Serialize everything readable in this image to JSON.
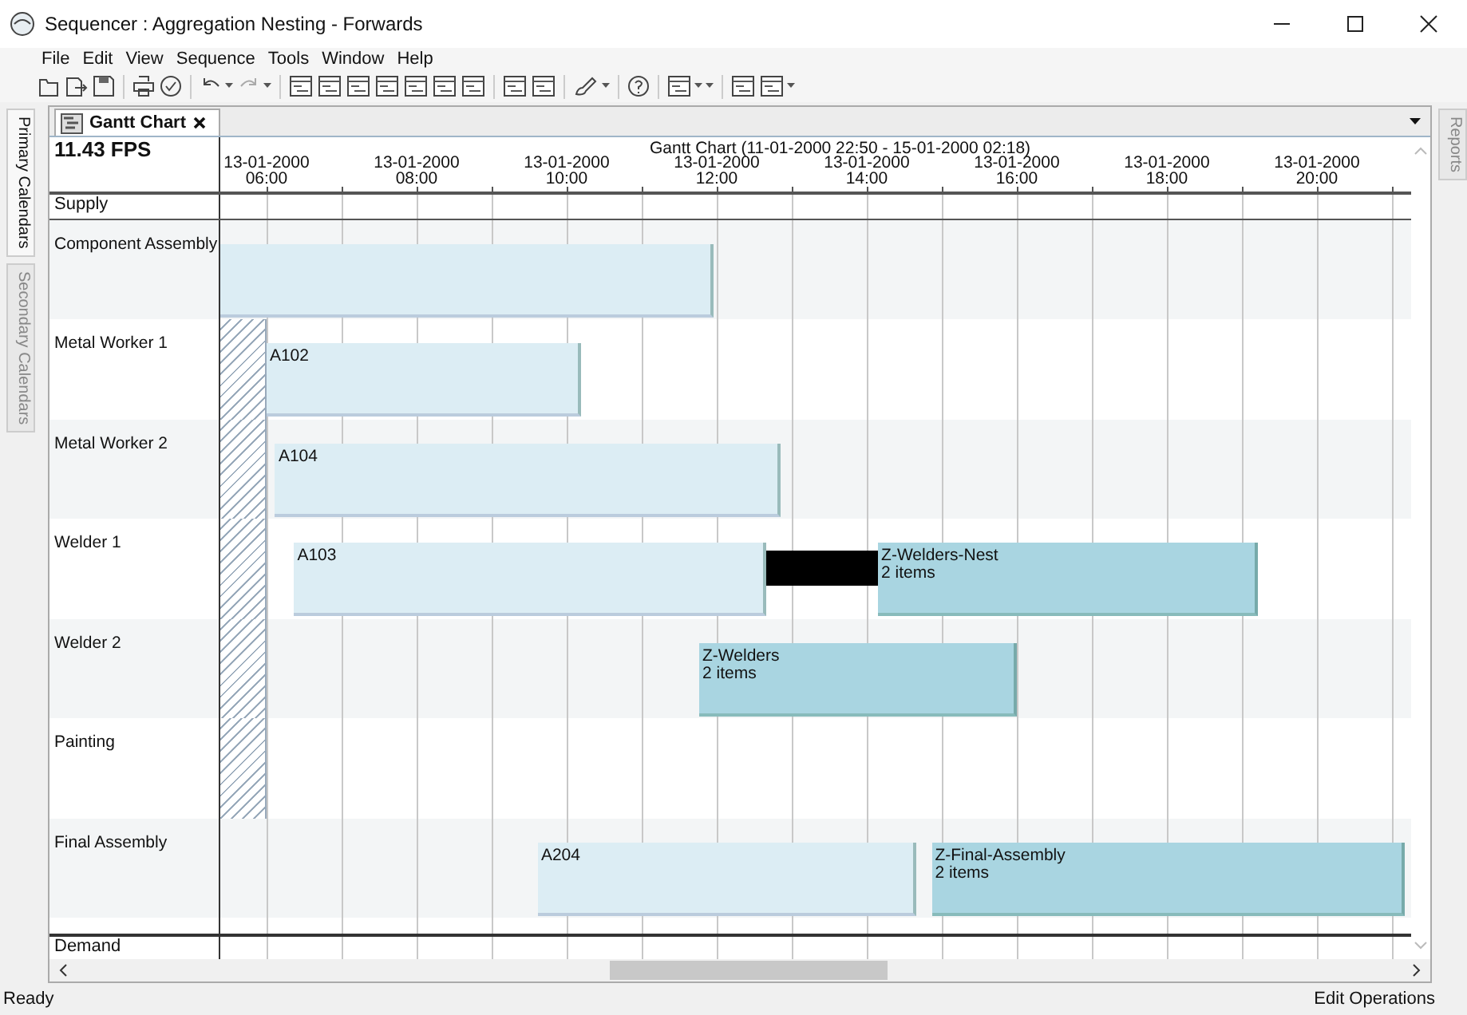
{
  "window": {
    "title": "Sequencer : Aggregation Nesting - Forwards"
  },
  "menu": [
    "File",
    "Edit",
    "View",
    "Sequence",
    "Tools",
    "Window",
    "Help"
  ],
  "left_tabs": [
    {
      "label": "Primary Calendars",
      "selected": true
    },
    {
      "label": "Secondary Calendars",
      "selected": false
    }
  ],
  "right_tabs": [
    {
      "label": "Reports",
      "selected": false
    }
  ],
  "document_tabs": [
    {
      "label": "Gantt Chart",
      "selected": true
    }
  ],
  "gantt": {
    "fps": "11.43 FPS",
    "title": "Gantt Chart  (11-01-2000 22:50 - 15-01-2000 02:18)",
    "ticks": [
      {
        "date": "13-01-2000",
        "time": "06:00"
      },
      {
        "date": "13-01-2000",
        "time": "08:00"
      },
      {
        "date": "13-01-2000",
        "time": "10:00"
      },
      {
        "date": "13-01-2000",
        "time": "12:00"
      },
      {
        "date": "13-01-2000",
        "time": "14:00"
      },
      {
        "date": "13-01-2000",
        "time": "16:00"
      },
      {
        "date": "13-01-2000",
        "time": "18:00"
      },
      {
        "date": "13-01-2000",
        "time": "20:00"
      }
    ],
    "supply_label": "Supply",
    "rows": [
      {
        "label": "Component Assembly",
        "bars": [
          {
            "kind": "task"
          }
        ]
      },
      {
        "label": "Metal Worker 1",
        "bars": [
          {
            "kind": "nonworking"
          },
          {
            "kind": "task",
            "name": "A102"
          }
        ]
      },
      {
        "label": "Metal Worker 2",
        "bars": [
          {
            "kind": "nonworking"
          },
          {
            "kind": "task",
            "name": "A104"
          }
        ]
      },
      {
        "label": "Welder 1",
        "bars": [
          {
            "kind": "nonworking"
          },
          {
            "kind": "task",
            "name": "A103"
          },
          {
            "kind": "gap"
          },
          {
            "kind": "aggregate",
            "name": "Z-Welders-Nest",
            "detail": "2 items"
          }
        ]
      },
      {
        "label": "Welder 2",
        "bars": [
          {
            "kind": "nonworking"
          },
          {
            "kind": "aggregate",
            "name": "Z-Welders",
            "detail": "2 items"
          }
        ]
      },
      {
        "label": "Painting",
        "bars": [
          {
            "kind": "nonworking"
          }
        ]
      },
      {
        "label": "Final Assembly",
        "bars": [
          {
            "kind": "task",
            "name": "A204"
          },
          {
            "kind": "aggregate",
            "name": "Z-Final-Assembly",
            "detail": "2 items"
          }
        ]
      }
    ],
    "demand_label": "Demand"
  },
  "status_bar": {
    "left": "Ready",
    "right": "Edit Operations"
  }
}
